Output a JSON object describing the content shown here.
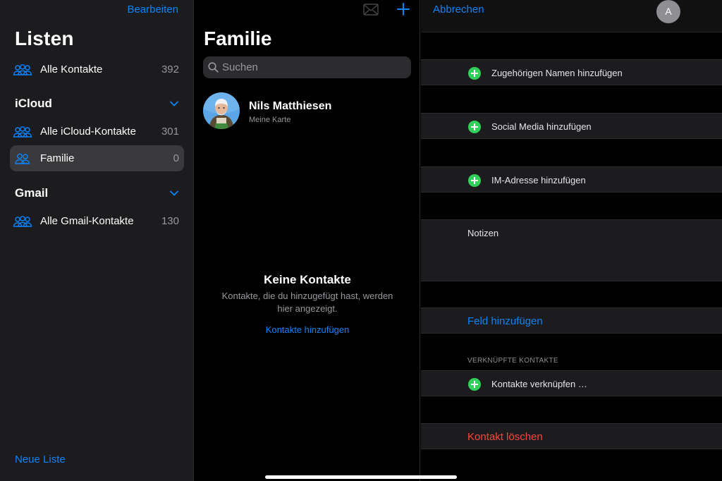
{
  "sidebar": {
    "edit_label": "Bearbeiten",
    "title": "Listen",
    "all_contacts": {
      "label": "Alle Kontakte",
      "count": "392"
    },
    "sections": [
      {
        "title": "iCloud",
        "items": [
          {
            "label": "Alle iCloud-Kontakte",
            "count": "301"
          },
          {
            "label": "Familie",
            "count": "0",
            "selected": true
          }
        ]
      },
      {
        "title": "Gmail",
        "items": [
          {
            "label": "Alle Gmail-Kontakte",
            "count": "130"
          }
        ]
      }
    ],
    "new_list_label": "Neue Liste"
  },
  "middle": {
    "title": "Familie",
    "search_placeholder": "Suchen",
    "me_card": {
      "name": "Nils Matthiesen",
      "subtitle": "Meine Karte"
    },
    "empty": {
      "title": "Keine Kontakte",
      "text": "Kontakte, die du hinzugefügt hast, werden hier angezeigt.",
      "link": "Kontakte hinzufügen"
    }
  },
  "detail": {
    "cancel_label": "Abbrechen",
    "avatar_initial": "A",
    "add_related_name": "Zugehörigen Namen hinzufügen",
    "add_social": "Social Media hinzufügen",
    "add_im": "IM-Adresse hinzufügen",
    "notes_label": "Notizen",
    "add_field": "Feld hinzufügen",
    "linked_section": "VERKNÜPFTE KONTAKTE",
    "link_contacts": "Kontakte verknüpfen …",
    "delete_contact": "Kontakt löschen"
  },
  "colors": {
    "accent": "#0a84ff",
    "add_green": "#30d158",
    "danger": "#ff453a",
    "sidebar_bg": "#1c1c1e",
    "selected_row": "#3a3a3c"
  },
  "icons": {
    "group": "person-group-icon",
    "chevron": "chevron-down-icon",
    "mail": "envelope-icon",
    "plus": "plus-icon",
    "search": "magnifier-icon",
    "add": "green-plus-circle-icon"
  }
}
